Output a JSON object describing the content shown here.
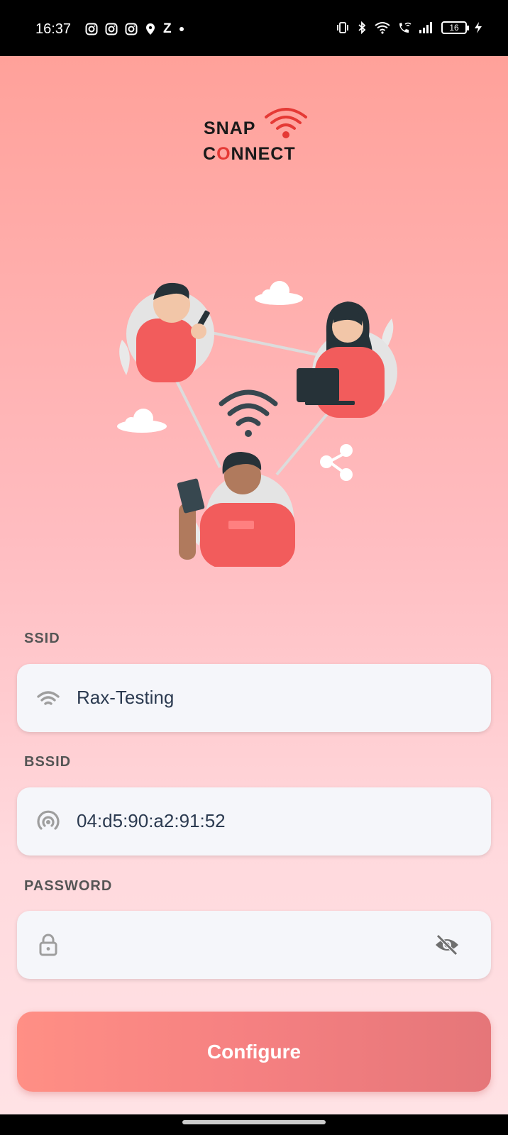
{
  "status_bar": {
    "time": "16:37",
    "z_label": "Z",
    "battery_level": "16",
    "left_icons": [
      "instagram-icon",
      "instagram-icon",
      "instagram-icon",
      "location-pin-icon"
    ],
    "right_icons": [
      "vibrate-icon",
      "bluetooth-icon",
      "wifi-icon",
      "wifi-call-icon",
      "signal-icon",
      "battery-icon",
      "charging-icon"
    ]
  },
  "logo": {
    "line1": "SNAP",
    "line2_prefix": "C",
    "line2_red": "O",
    "line2_suffix": "NNECT"
  },
  "form": {
    "ssid": {
      "label": "SSID",
      "value": "Rax-Testing",
      "icon": "wifi-icon"
    },
    "bssid": {
      "label": "BSSID",
      "value": "04:d5:90:a2:91:52",
      "icon": "broadcast-icon"
    },
    "password": {
      "label": "PASSWORD",
      "value": "",
      "icon": "lock-icon",
      "toggle_icon": "eye-off-icon"
    }
  },
  "configure_button": {
    "label": "Configure"
  },
  "colors": {
    "brand_red": "#e53935",
    "button_start": "#ff8f85",
    "button_end": "#e57679",
    "shirt_red": "#f25c5c"
  }
}
